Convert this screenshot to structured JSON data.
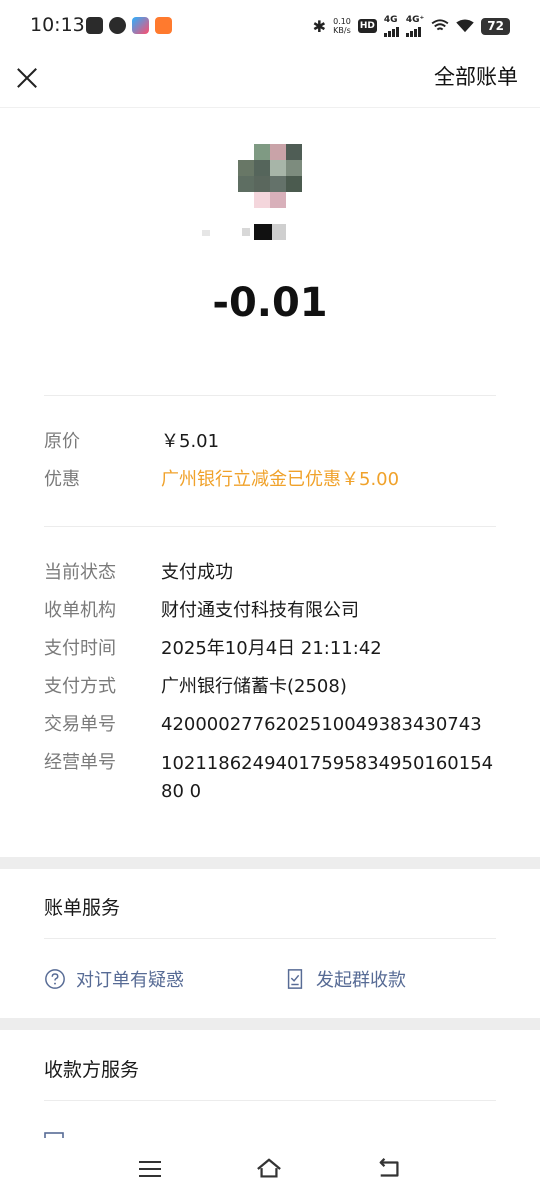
{
  "status_bar": {
    "time": "10:13",
    "net_speed_top": "0.10",
    "net_speed_unit": "KB/s",
    "hd_label": "HD",
    "sim1_label": "4G",
    "sim2_label": "4G⁺",
    "battery": "72"
  },
  "nav": {
    "all_bills_label": "全部账单"
  },
  "payment": {
    "amount": "-0.01"
  },
  "price_info": {
    "original_label": "原价",
    "original_value": "￥5.01",
    "discount_label": "优惠",
    "discount_value": "广州银行立减金已优惠￥5.00",
    "discount_color": "#f0a22b"
  },
  "details": [
    {
      "label": "当前状态",
      "value": "支付成功"
    },
    {
      "label": "收单机构",
      "value": "财付通支付科技有限公司"
    },
    {
      "label": "支付时间",
      "value": "2025年10月4日 21:11:42"
    },
    {
      "label": "支付方式",
      "value": "广州银行储蓄卡(2508)"
    },
    {
      "label": "交易单号",
      "value": "4200002776202510049383430743"
    },
    {
      "label": "经营单号",
      "value": "1021186249401759583495016015480 0"
    }
  ],
  "bill_service": {
    "title": "账单服务",
    "order_question": "对订单有疑惑",
    "group_collect": "发起群收款",
    "link_color": "#576b95"
  },
  "payee_service": {
    "title": "收款方服务"
  }
}
